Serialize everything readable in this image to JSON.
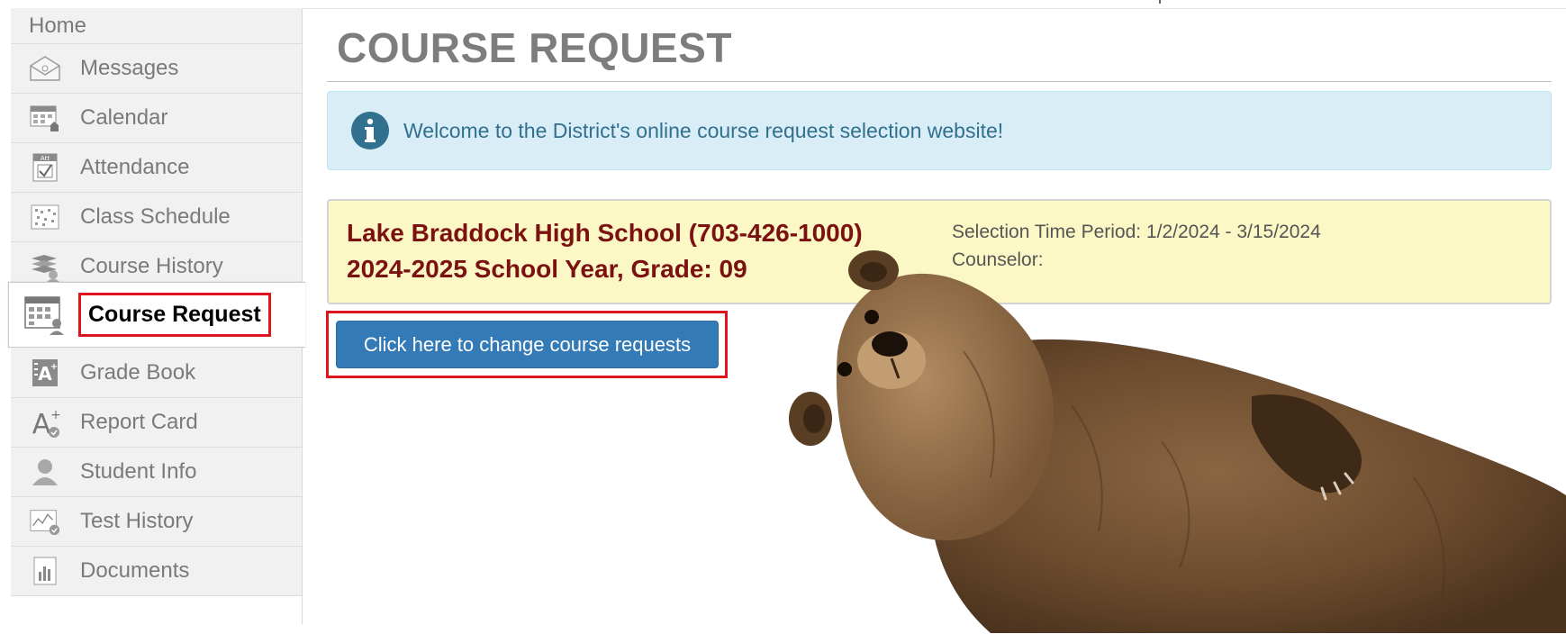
{
  "sidebar": {
    "items": [
      {
        "label": "Home",
        "icon": "home"
      },
      {
        "label": "Messages",
        "icon": "envelope-icon"
      },
      {
        "label": "Calendar",
        "icon": "calendar-icon"
      },
      {
        "label": "Attendance",
        "icon": "attendance-icon"
      },
      {
        "label": "Class Schedule",
        "icon": "schedule-icon"
      },
      {
        "label": "Course History",
        "icon": "books-icon"
      },
      {
        "label": "Course Request",
        "icon": "course-request-icon"
      },
      {
        "label": "Grade Book",
        "icon": "gradebook-icon"
      },
      {
        "label": "Report Card",
        "icon": "report-card-icon"
      },
      {
        "label": "Student Info",
        "icon": "student-icon"
      },
      {
        "label": "Test History",
        "icon": "chart-icon"
      },
      {
        "label": "Documents",
        "icon": "document-icon"
      }
    ],
    "active": "Course Request"
  },
  "main": {
    "title": "COURSE REQUEST",
    "info_message": "Welcome to the District's online course request selection website!",
    "school": {
      "name_line": "Lake Braddock High School (703-426-1000)",
      "year_line": "2024-2025 School Year, Grade: 09",
      "selection_period": "Selection Time Period: 1/2/2024 - 3/15/2024",
      "counselor": "Counselor:"
    },
    "change_button_label": "Click here to change course requests"
  },
  "colors": {
    "highlight_red": "#e0141e",
    "alert_bg": "#d9edf7",
    "alert_text": "#31708f",
    "panel_bg": "#fcf8c6",
    "school_text": "#7b1111",
    "button_blue": "#337ab7"
  }
}
